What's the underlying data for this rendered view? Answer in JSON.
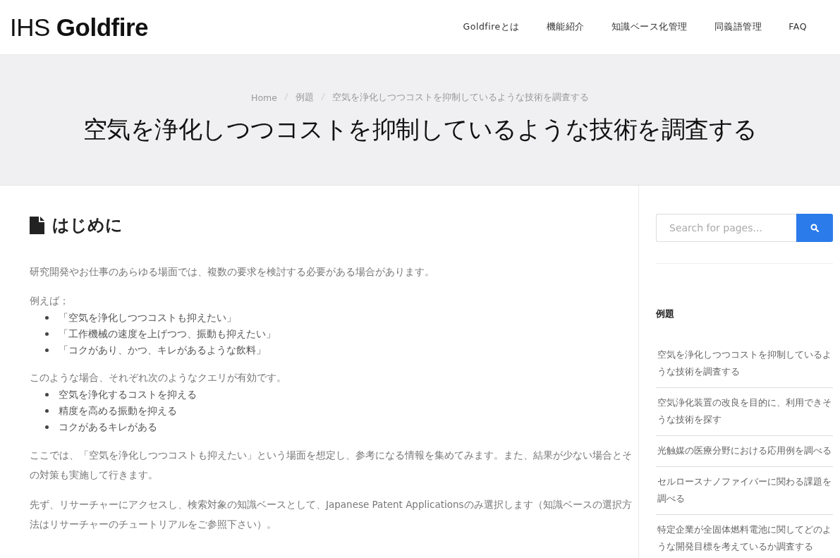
{
  "logo": {
    "prefix": "IHS",
    "name": "Goldfire"
  },
  "nav": [
    {
      "label": "Goldfireとは"
    },
    {
      "label": "機能紹介"
    },
    {
      "label": "知識ベース化管理"
    },
    {
      "label": "同義語管理"
    },
    {
      "label": "FAQ"
    }
  ],
  "breadcrumb": [
    "Home",
    "例題",
    "空気を浄化しつつコストを抑制しているような技術を調査する"
  ],
  "page_title": "空気を浄化しつつコストを抑制しているような技術を調査する",
  "section_heading": "はじめに",
  "content": [
    {
      "kind": "paragraph",
      "text": "研究開発やお仕事のあらゆる場面では、複数の要求を検討する必要がある場合があります。"
    },
    {
      "kind": "lead",
      "text": "例えば；"
    },
    {
      "kind": "list",
      "items": [
        "「空気を浄化しつつコストも抑えたい」",
        "「工作機械の速度を上げつつ、振動も抑えたい」",
        "「コクがあり、かつ、キレがあるような飲料」"
      ]
    },
    {
      "kind": "lead",
      "text": "このような場合、それぞれ次のようなクエリが有効です。"
    },
    {
      "kind": "list",
      "items": [
        "空気を浄化するコストを抑える",
        "精度を高める振動を抑える",
        "コクがあるキレがある"
      ]
    },
    {
      "kind": "paragraph",
      "text": "ここでは、「空気を浄化しつつコストも抑えたい」という場面を想定し、参考になる情報を集めてみます。また、結果が少ない場合とその対策も実施して行きます。"
    },
    {
      "kind": "paragraph",
      "text": "先ず、リサーチャーにアクセスし、検索対象の知識ベースとして、Japanese Patent Applicationsのみ選択します（知識ベースの選択方法はリサーチャーのチュートリアルをご参照下さい）。"
    }
  ],
  "sidebar": {
    "search": {
      "placeholder": "Search for pages..."
    },
    "heading": "例題",
    "items": [
      "空気を浄化しつつコストを抑制しているような技術を調査する",
      "空気浄化装置の改良を目的に、利用できそうな技術を探す",
      "光触媒の医療分野における応用例を調べる",
      "セルロースナノファイバーに関わる課題を調べる",
      "特定企業が全固体燃料電池に関してどのような開発目標を考えているか調査する"
    ]
  }
}
